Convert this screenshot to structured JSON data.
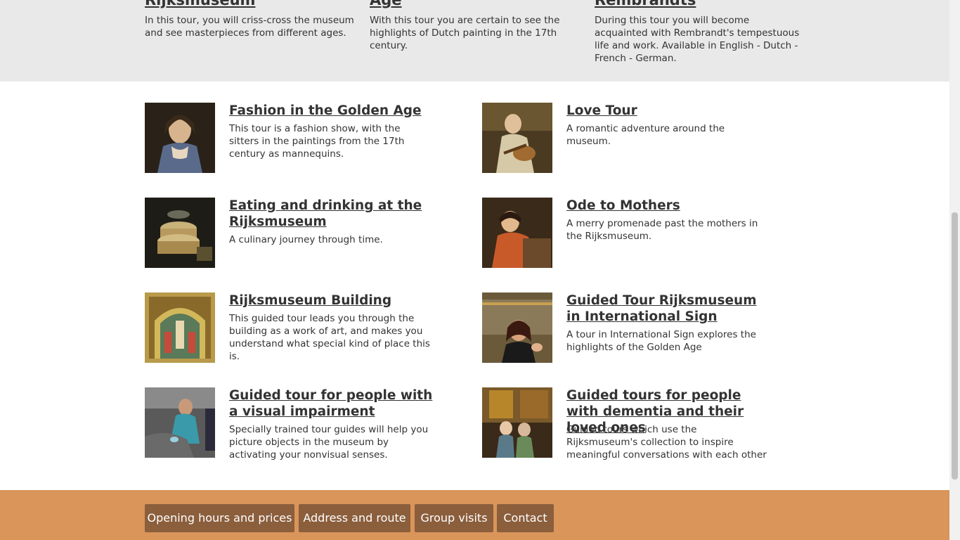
{
  "top_tours": [
    {
      "title": "Rijksmuseum",
      "desc": "In this tour, you will criss-cross the museum and see masterpieces from different ages."
    },
    {
      "title": "Age",
      "desc": "With this tour you are certain to see the highlights of Dutch painting in the 17th century."
    },
    {
      "title": "Rembrandts",
      "desc": "During this tour you will become acquainted with Rembrandt's tempestuous life and work. Available in English - Dutch - French - German."
    }
  ],
  "tours": [
    {
      "title": "Fashion in the Golden Age",
      "desc": "This tour is a fashion show, with the sitters in the paintings from the 17th century as mannequins."
    },
    {
      "title": "Love Tour",
      "desc": "A romantic adventure around the museum."
    },
    {
      "title": "Eating and drinking at the Rijksmuseum",
      "desc": "A culinary journey through time."
    },
    {
      "title": "Ode to Mothers",
      "desc": "A merry promenade past the mothers in the Rijksmuseum."
    },
    {
      "title": "Rijksmuseum Building",
      "desc": "This guided tour leads you through the building as a work of art, and makes you understand what special kind of place this is."
    },
    {
      "title": "Guided Tour Rijksmuseum in International Sign",
      "desc": "A tour in International Sign explores the highlights of the Golden Age"
    },
    {
      "title": "Guided tour for people with a visual impairment",
      "desc": "Specially trained tour guides will help you picture objects in the museum by activating your nonvisual senses."
    },
    {
      "title": "Guided tours for people with dementia and their loved ones",
      "desc": "Guided tours which use the Rijksmuseum's collection to inspire meaningful conversations with each other"
    }
  ],
  "footer": {
    "buttons": [
      "Opening hours and prices",
      "Address and route",
      "Group visits",
      "Contact"
    ]
  },
  "colors": {
    "top_band": "#e9e9e9",
    "footer_bg": "#d9955a",
    "footer_button": "#8b5e3c",
    "text": "#333333"
  }
}
